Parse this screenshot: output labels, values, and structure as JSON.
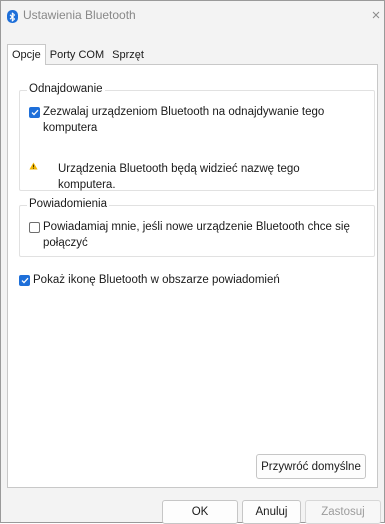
{
  "window": {
    "title": "Ustawienia Bluetooth",
    "close_glyph": "×",
    "accent": "#1e6fd9"
  },
  "tabs": [
    {
      "label": "Opcje",
      "active": true
    },
    {
      "label": "Porty COM",
      "active": false
    },
    {
      "label": "Sprzęt",
      "active": false
    }
  ],
  "discovery": {
    "title": "Odnajdowanie",
    "allow_discovery": {
      "checked": true,
      "line1": "Zezwalaj urządzeniom Bluetooth na odnajdywanie tego",
      "line2": "komputera"
    },
    "warning": {
      "icon": "warning-icon",
      "line1": "Urządzenia Bluetooth będą widzieć nazwę tego",
      "line2": "komputera."
    }
  },
  "notifications": {
    "title": "Powiadomienia",
    "notify_new_device": {
      "checked": false,
      "line1": "Powiadamiaj mnie, jeśli nowe urządzenie Bluetooth chce się",
      "line2": "połączyć"
    }
  },
  "show_icon": {
    "checked": true,
    "label": "Pokaż ikonę Bluetooth w obszarze powiadomień"
  },
  "buttons": {
    "restore_defaults": "Przywróć domyślne",
    "ok": "OK",
    "cancel": "Anuluj",
    "apply": "Zastosuj"
  }
}
